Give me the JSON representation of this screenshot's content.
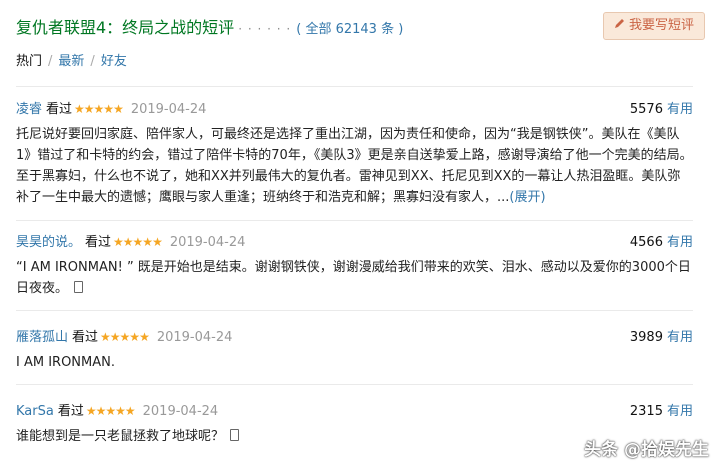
{
  "header": {
    "title": "复仇者联盟4：终局之战的短评",
    "dots": "· · · · · ·",
    "count": "( 全部 62143 条 )",
    "write_button": "我要写短评"
  },
  "tabs": [
    {
      "label": "热门",
      "active": true
    },
    {
      "label": "最新",
      "active": false
    },
    {
      "label": "好友",
      "active": false
    }
  ],
  "reviews": [
    {
      "user": "凌睿",
      "seen": "看过",
      "stars": "★★★★★",
      "date": "2019-04-24",
      "votes": "5576",
      "useful": "有用",
      "content": "托尼说好要回归家庭、陪伴家人，可最终还是选择了重出江湖，因为责任和使命，因为“我是钢铁侠”。美队在《美队1》错过了和卡特的约会，错过了陪伴卡特的70年，《美队3》更是亲自送挚爱上路，感谢导演给了他一个完美的结局。至于黑寡妇，什么也不说了，她和XX并列最伟大的复仇者。雷神见到XX、托尼见到XX的一幕让人热泪盈眶。美队弥补了一生中最大的遗憾；鹰眼与家人重逢；班纳终于和浩克和解；黑寡妇没有家人，...",
      "expand": "(展开)"
    },
    {
      "user": "昊昊的说。",
      "seen": "看过",
      "stars": "★★★★★",
      "date": "2019-04-24",
      "votes": "4566",
      "useful": "有用",
      "content": "“I AM IRONMAN! ” 既是开始也是结束。谢谢钢铁侠，谢谢漫威给我们带来的欢笑、泪水、感动以及爱你的3000个日日夜夜。"
    },
    {
      "user": "雁落孤山",
      "seen": "看过",
      "stars": "★★★★★",
      "date": "2019-04-24",
      "votes": "3989",
      "useful": "有用",
      "content": "I AM IRONMAN."
    },
    {
      "user": "KarSa",
      "seen": "看过",
      "stars": "★★★★★",
      "date": "2019-04-24",
      "votes": "2315",
      "useful": "有用",
      "content": "谁能想到是一只老鼠拯救了地球呢？"
    }
  ],
  "watermark": "头条 @拾娱先生",
  "colors": {
    "link": "#3377aa",
    "title": "#007722",
    "star": "#f5a623",
    "button_bg": "#fae9da",
    "button_text": "#ca6445"
  }
}
